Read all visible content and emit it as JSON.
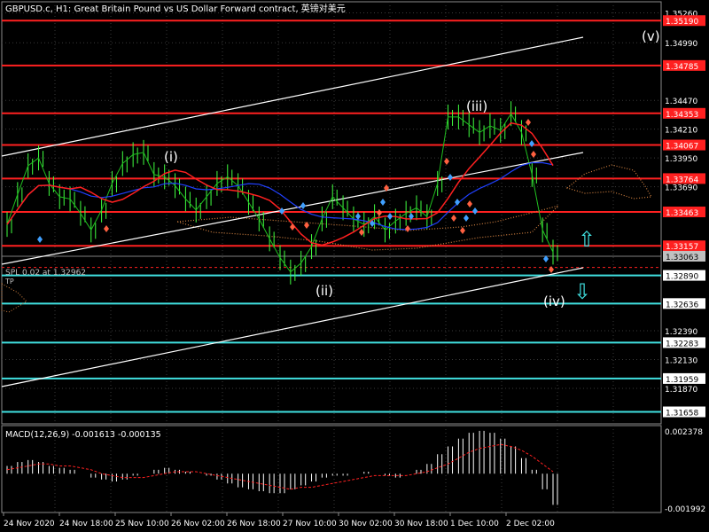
{
  "header": {
    "title": "GBPUSD.c, H1:  Great Britain Pound vs US Dollar Forward contract, 英镑对美元",
    "macd_label": "MACD(12,26,9) -0.001613 -0.000135",
    "spl_label": "SPL 0.02 at 1.32962",
    "tp_label": "TP"
  },
  "colors": {
    "background": "#000000",
    "grid": "#3a3a3a",
    "red_level": "#ff2020",
    "cyan_level": "#40e0e0",
    "price_line": "#20c020",
    "candle": "#40ff40",
    "trend_line": "#ffffff",
    "macd_histogram": "#ffffff",
    "macd_signal": "#ff2020"
  },
  "price_axis": {
    "ticks": [
      "1.35260",
      "1.34990",
      "1.34470",
      "1.34210",
      "1.33950",
      "1.33690",
      "1.32390",
      "1.32130",
      "1.31870"
    ],
    "red_levels": [
      "1.35190",
      "1.34785",
      "1.34353",
      "1.34067",
      "1.33764",
      "1.33463",
      "1.33157"
    ],
    "cyan_levels": [
      "1.32890",
      "1.32636",
      "1.32283",
      "1.31959",
      "1.31658"
    ],
    "current_price": "1.33063"
  },
  "macd_axis": {
    "ticks": [
      "0.002378",
      "-0.001992"
    ]
  },
  "time_axis": {
    "labels": [
      "24 Nov 2020",
      "24 Nov 18:00",
      "25 Nov 10:00",
      "26 Nov 02:00",
      "26 Nov 18:00",
      "27 Nov 10:00",
      "30 Nov 02:00",
      "30 Nov 18:00",
      "1 Dec 10:00",
      "2 Dec 02:00"
    ]
  },
  "wave_labels": [
    "(i)",
    "(ii)",
    "(iii)",
    "(iv)",
    "(v)"
  ],
  "arrows": {
    "up": "⇧",
    "down": "⇩"
  },
  "chart_data": {
    "type": "line",
    "title": "GBPUSD.c, H1",
    "series": [
      {
        "name": "GBPUSD.c",
        "values": [
          1.3335,
          1.3362,
          1.3388,
          1.3395,
          1.3372,
          1.336,
          1.3358,
          1.3345,
          1.333,
          1.3348,
          1.3372,
          1.339,
          1.3398,
          1.34,
          1.338,
          1.3378,
          1.337,
          1.3358,
          1.3348,
          1.336,
          1.3372,
          1.3378,
          1.337,
          1.3355,
          1.334,
          1.3322,
          1.3305,
          1.3292,
          1.33,
          1.3315,
          1.334,
          1.336,
          1.335,
          1.334,
          1.3335,
          1.3342,
          1.333,
          1.3338,
          1.3345,
          1.335,
          1.3342,
          1.3372,
          1.3432,
          1.3432,
          1.3425,
          1.3418,
          1.3424,
          1.342,
          1.3435,
          1.3418,
          1.338,
          1.333,
          1.331
        ]
      }
    ],
    "ylim": [
      1.3155,
      1.3536
    ],
    "macd": {
      "ylim": [
        -0.001992,
        0.002378
      ],
      "values": [
        0.0004,
        0.0006,
        0.0007,
        0.0006,
        0.0004,
        0.0003,
        0.0002,
        0.0,
        -0.0002,
        -0.0003,
        -0.0004,
        -0.0003,
        -0.0001,
        0.0,
        0.0002,
        0.0003,
        0.0002,
        0.0001,
        0.0,
        -0.0001,
        -0.0003,
        -0.0005,
        -0.0007,
        -0.0008,
        -0.0009,
        -0.001,
        -0.001,
        -0.0008,
        -0.0006,
        -0.0004,
        -0.0002,
        -0.0001,
        -0.0001,
        0.0,
        0.0001,
        0.0,
        -0.0001,
        -0.0002,
        0.0,
        0.0002,
        0.0005,
        0.001,
        0.0014,
        0.0018,
        0.0021,
        0.0022,
        0.0021,
        0.0018,
        0.0014,
        0.0008,
        0.0002,
        -0.0008,
        -0.0016
      ],
      "signal": [
        0.0002,
        0.0003,
        0.0004,
        0.0005,
        0.0005,
        0.0004,
        0.0004,
        0.0003,
        0.0002,
        0.0,
        -0.0001,
        -0.0002,
        -0.0002,
        -0.0002,
        -0.0001,
        0.0,
        0.0001,
        0.0001,
        0.0001,
        0.0,
        -0.0001,
        -0.0002,
        -0.0003,
        -0.0004,
        -0.0005,
        -0.0006,
        -0.0007,
        -0.0008,
        -0.0007,
        -0.0007,
        -0.0006,
        -0.0005,
        -0.0004,
        -0.0003,
        -0.0002,
        -0.0001,
        -0.0001,
        -0.0001,
        -0.0001,
        0.0,
        0.0001,
        0.0003,
        0.0005,
        0.0008,
        0.0011,
        0.0013,
        0.0014,
        0.0015,
        0.0014,
        0.0012,
        0.0009,
        0.0005,
        0.0001
      ]
    }
  }
}
